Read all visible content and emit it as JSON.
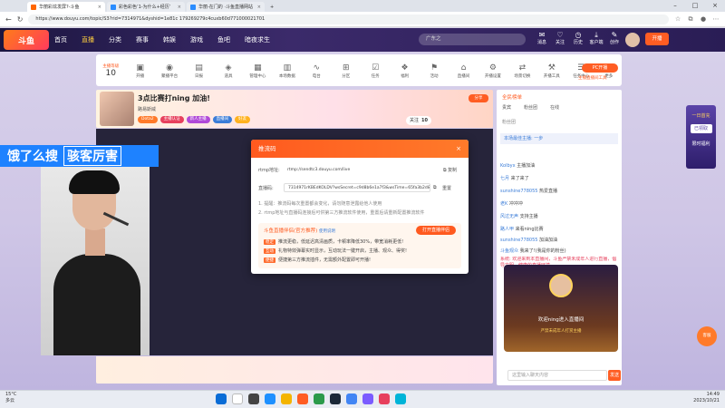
{
  "browser": {
    "tabs": [
      {
        "title": "华丽彩炫发屏?-斗鱼",
        "active": true
      },
      {
        "title": "彩色彩色‘1-为什么+经历’",
        "active": false
      },
      {
        "title": "华丽-在门的 ·斗鱼直播网站",
        "active": false
      }
    ],
    "new_tab": "+",
    "url": "https://www.douyu.com/topic/S3?rid=7314971&dyshid=1e81c 179269279c4cuxb60d771000021701"
  },
  "site": {
    "logo": "斗鱼",
    "nav": [
      "首页",
      "直播",
      "分类",
      "赛事",
      "韩娱",
      "游戏",
      "鱼吧",
      "暗夜求生"
    ],
    "nav_active": "直播",
    "search_placeholder": "广东之",
    "header_icons": [
      "消息",
      "关注",
      "历史",
      "客户端",
      "创作"
    ],
    "open_live": "开播"
  },
  "anchor_bar": {
    "level_label": "主播等级",
    "level_value": "10",
    "buttons": [
      "开播",
      "聚播平台",
      "日报",
      "道具",
      "管理中心",
      "本场数据",
      "电台",
      "分区",
      "任务",
      "福利",
      "活动",
      "直播间",
      "开播设置",
      "场景切换",
      "开播工具",
      "任务中心",
      "更多"
    ],
    "pc_start": "PC开播",
    "pc_sub": "主播直播间工具"
  },
  "room": {
    "title": "3点比赛打ning 加油!",
    "anchor": "路易斯威",
    "tags": [
      "Dota2",
      "主播认证",
      "新人主播",
      "直播间",
      "好友"
    ],
    "share": "分享",
    "follow": "关注",
    "follow_count": "10"
  },
  "overlay_ad": {
    "left": "饿了么搜",
    "right": "骇客厉害"
  },
  "modal": {
    "title": "推流码",
    "close": "×",
    "rtmp_label": "rtmp地址:",
    "rtmp_value": "rtmp://sendtc3.douyu.com/live",
    "copy": "复制",
    "code_label": "直播码:",
    "code_value": "7314971rKBEdKOLDV?wsSecret=c9d8b6e1a7f3&wsTime=65fa3b2d&wsSeek=off&wm=0&tw=0&roirecognition=0&record=flv&origin=tct&txHost=08ddend_id",
    "reset": "重置",
    "note1": "1. 提醒：推流码每次重置都会变化，请勿随意泄露给他人使用",
    "note2": "2. rtmp地址与直播码连接后可供第三方推流软件使用，重置后请重新配置推流软件",
    "promo_title": "斗鱼直播伴侣(官方推荐)",
    "promo_badge": "使用说明",
    "open_button": "打开直播伴侣",
    "promo_lines": [
      {
        "tag": "稳定",
        "text": "推流更稳，低延迟高清画质，卡顿率降低30%，带宽消耗更低!"
      },
      {
        "tag": "互动",
        "text": "礼物特效弹幕实时显示，互动玩法一键开启，主播、观众、得奖!"
      },
      {
        "tag": "便捷",
        "text": "便捷第三方推流插件，无需额外配置即可开播!"
      }
    ]
  },
  "right_panel": {
    "gift_title": "全民榜单",
    "tabs": [
      "贵宾",
      "粉丝团",
      "在线"
    ],
    "rank_label": "粉丝团",
    "announcement": "本场最佳主播: 一步",
    "chat": [
      {
        "user": "Kolbyx",
        "text": "主播加油"
      },
      {
        "user": "七月",
        "text": "来了来了"
      },
      {
        "user": "sunshine778055",
        "text": "热爱直播"
      },
      {
        "user": "老K",
        "text": "冲冲冲"
      },
      {
        "user": "风过无声",
        "text": "支持主播"
      },
      {
        "user": "路人甲",
        "text": "来看ning比赛"
      },
      {
        "user": "sunshine778055",
        "text": "加油加油"
      },
      {
        "user": "斗鱼观众",
        "text": "我来了!(我是你的粉丝)"
      },
      {
        "user": "系统",
        "text": "欢迎来到本直播间，斗鱼严禁未成年人进行直播，倡导文明、健康的直播环境"
      }
    ],
    "card_title": "欢迎ning进入直播间",
    "card_sub": "严禁未成年人打赏主播",
    "input_placeholder": "这里输入聊天内容",
    "send": "发送"
  },
  "side_widget": {
    "title": "一日首充",
    "label": "已领取",
    "sub": "限时福利"
  },
  "float_btn": "客服",
  "taskbar": {
    "weather_temp": "15°C",
    "weather_desc": "多云",
    "time": "14:49",
    "date": "2023/10/21"
  }
}
